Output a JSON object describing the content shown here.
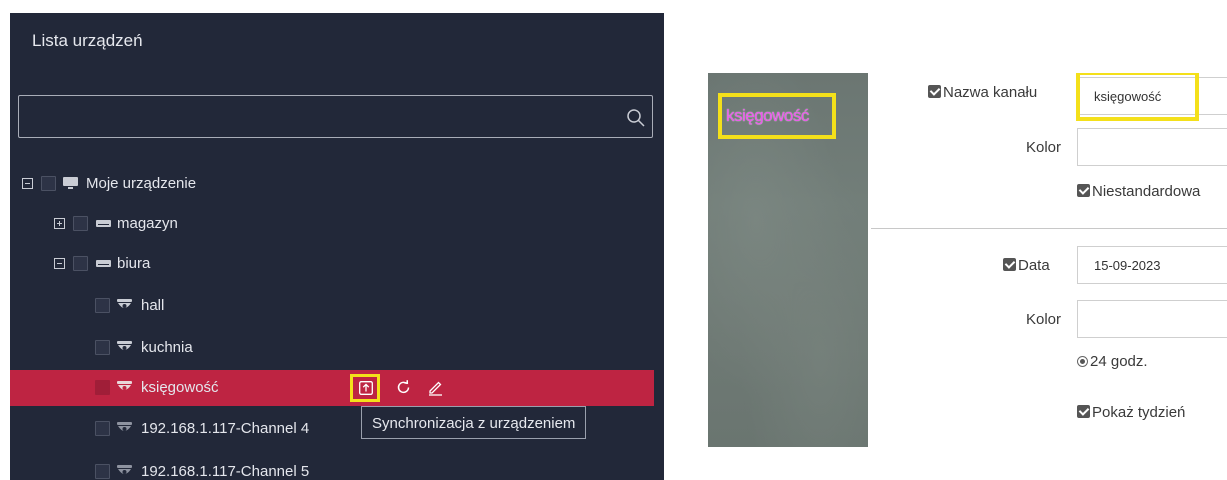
{
  "device_list": {
    "title": "Lista urządzeń",
    "search": {
      "placeholder": "",
      "value": ""
    },
    "tree": {
      "root": "Moje urządzenie",
      "magazyn": "magazyn",
      "biura": "biura",
      "hall": "hall",
      "kuchnia": "kuchnia",
      "ksiegowosc": "księgowość",
      "ch4": "192.168.1.117-Channel 4",
      "ch5": "192.168.1.117-Channel 5"
    },
    "tooltip": "Synchronizacja z urządzeniem",
    "colors": {
      "panel_bg": "#222839",
      "selected_row": "#be2442",
      "highlight": "#f4e01a"
    }
  },
  "osd_settings": {
    "preview_overlay_text": "księgowość",
    "channel_name_label": "Nazwa kanału",
    "channel_name_value": "księgowość",
    "color_label": "Kolor",
    "custom_label": "Niestandardowa",
    "date_label": "Data",
    "date_value": "15-09-2023",
    "color_label_2": "Kolor",
    "time_format_label": "24 godz.",
    "show_week_label": "Pokaż tydzień",
    "colors": {
      "overlay_text": "#ea56ea"
    }
  }
}
